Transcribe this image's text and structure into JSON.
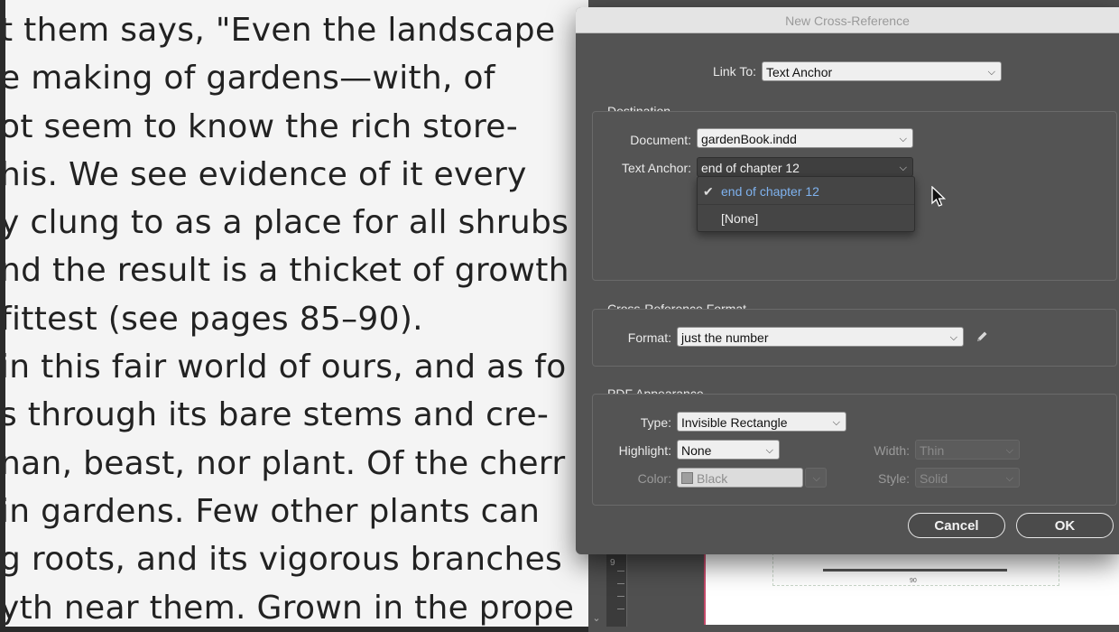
{
  "document": {
    "lines": [
      "t them says, \"Even the landscape",
      "e making of gardens—with, of",
      "ot seem to know the rich store-",
      "his. We see evidence of it every",
      "y clung to as a place for all shrubs",
      "nd the result is a thicket of growth",
      " fittest (see pages 85–90).",
      " in this fair world of ours, and as fo",
      "s through its bare stems and cre-",
      "nan, beast, nor plant. Of the cherr",
      " in gardens. Few other plants can",
      "g roots, and its vigorous branches",
      "yth near them. Grown in the prope"
    ]
  },
  "dialog": {
    "title": "New Cross-Reference",
    "link_to": {
      "label": "Link To:",
      "value": "Text Anchor"
    },
    "destination": {
      "title": "Destination",
      "document_label": "Document:",
      "document_value": "gardenBook.indd",
      "anchor_label": "Text Anchor:",
      "anchor_value": "end of chapter 12",
      "anchor_options": [
        {
          "label": "end of chapter 12",
          "selected": true
        },
        {
          "label": "[None]",
          "selected": false
        }
      ]
    },
    "format_section": {
      "title": "Cross-Reference Format",
      "format_label": "Format:",
      "format_value": "just the number"
    },
    "pdf": {
      "title": "PDF Appearance",
      "type_label": "Type:",
      "type_value": "Invisible Rectangle",
      "highlight_label": "Highlight:",
      "highlight_value": "None",
      "color_label": "Color:",
      "color_value": "Black",
      "width_label": "Width:",
      "width_value": "Thin",
      "style_label": "Style:",
      "style_value": "Solid"
    },
    "buttons": {
      "cancel": "Cancel",
      "ok": "OK"
    }
  },
  "ruler": {
    "mark": "9"
  },
  "page_number": "90",
  "colors": {
    "dialog_bg": "#535353",
    "menu_selected": "#7fb2ee",
    "page_border": "#c44a6a"
  },
  "icons": [
    "chevron-down-icon",
    "checkmark-icon",
    "pencil-icon",
    "mouse-cursor-icon"
  ]
}
